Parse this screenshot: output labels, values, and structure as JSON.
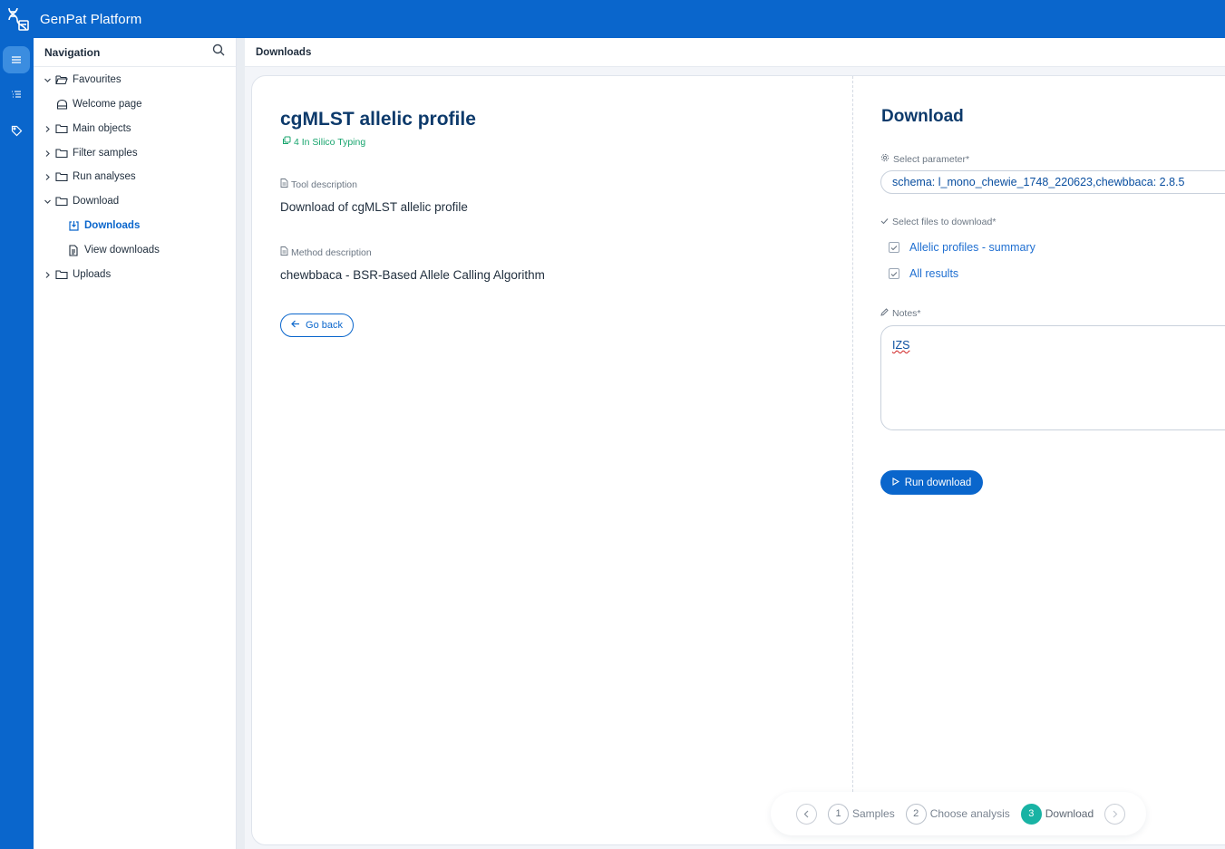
{
  "app": {
    "title": "GenPat Platform"
  },
  "rail": {
    "items": [
      "menu-icon",
      "list-icon",
      "tag-icon"
    ]
  },
  "navigation": {
    "title": "Navigation",
    "items": [
      {
        "label": "Favourites",
        "icon": "folder-open-icon",
        "chevron": "down"
      },
      {
        "label": "Welcome page",
        "icon": "home-icon"
      },
      {
        "label": "Main objects",
        "icon": "folder-icon",
        "chevron": "right"
      },
      {
        "label": "Filter samples",
        "icon": "folder-icon",
        "chevron": "right"
      },
      {
        "label": "Run analyses",
        "icon": "folder-icon",
        "chevron": "right"
      },
      {
        "label": "Download",
        "icon": "folder-icon",
        "chevron": "down"
      },
      {
        "label": "Downloads",
        "icon": "download-icon",
        "selected": true
      },
      {
        "label": "View downloads",
        "icon": "document-icon"
      },
      {
        "label": "Uploads",
        "icon": "folder-icon",
        "chevron": "right"
      }
    ]
  },
  "breadcrumb": "Downloads",
  "tool": {
    "title": "cgMLST allelic profile",
    "category": "4 In Silico Typing",
    "tool_description_label": "Tool description",
    "tool_description": "Download of cgMLST allelic profile",
    "method_description_label": "Method description",
    "method_description": "chewbbaca - BSR-Based Allele Calling Algorithm",
    "go_back_label": "Go back"
  },
  "download": {
    "title": "Download",
    "parameter_label": "Select parameter*",
    "parameter_value": "schema: l_mono_chewie_1748_220623,chewbbaca: 2.8.5",
    "files_label": "Select files to download*",
    "files": [
      {
        "label": "Allelic profiles - summary",
        "checked": true
      },
      {
        "label": "All results",
        "checked": true
      }
    ],
    "notes_label": "Notes*",
    "notes_value": "IZS",
    "run_label": "Run download"
  },
  "stepper": {
    "steps": [
      {
        "number": "1",
        "label": "Samples"
      },
      {
        "number": "2",
        "label": "Choose analysis"
      },
      {
        "number": "3",
        "label": "Download",
        "active": true
      }
    ]
  },
  "colors": {
    "brand": "#0a66cc",
    "accent_green": "#18a56e",
    "step_active": "#19b3a4"
  }
}
